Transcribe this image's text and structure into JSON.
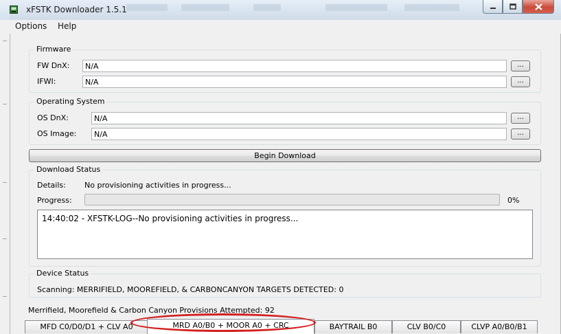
{
  "window": {
    "title": "xFSTK Downloader 1.5.1",
    "minimize_icon": "minimize-icon",
    "maximize_icon": "maximize-icon",
    "close_icon": "close-icon"
  },
  "menu": {
    "items": [
      "Options",
      "Help"
    ]
  },
  "firmware": {
    "legend": "Firmware",
    "fw_dnx_label": "FW DnX:",
    "fw_dnx_value": "N/A",
    "ifwi_label": "IFWI:",
    "ifwi_value": "N/A",
    "browse_label": "..."
  },
  "os": {
    "legend": "Operating System",
    "os_dnx_label": "OS DnX:",
    "os_dnx_value": "N/A",
    "os_image_label": "OS Image:",
    "os_image_value": "N/A",
    "browse_label": "..."
  },
  "begin_button": "Begin Download",
  "download_status": {
    "legend": "Download Status",
    "details_label": "Details:",
    "details_value": "No provisioning activities in progress...",
    "progress_label": "Progress:",
    "progress_value": 0,
    "progress_text": "0%",
    "log_line": "14:40:02 - XFSTK-LOG--No provisioning activities in progress..."
  },
  "device_status": {
    "legend": "Device Status",
    "scanning_text": "Scanning:  MERRIFIELD, MOOREFIELD, & CARBONCANYON TARGETS DETECTED: 0"
  },
  "provisions_text": "Merrifield, Moorefield & Carbon Canyon Provisions Attempted: 92",
  "tabs": [
    "MFD C0/D0/D1 + CLV A0",
    "MRD A0/B0 + MOOR A0 + CRC",
    "BAYTRAIL B0",
    "CLV B0/C0",
    "CLVP A0/B0/B1"
  ],
  "active_tab": "MRD A0/B0 + MOOR A0 + CRC",
  "colors": {
    "highlight_ellipse": "#d21f1f",
    "close_button": "#c94b3a",
    "titlebar": "#dbe6f1"
  }
}
